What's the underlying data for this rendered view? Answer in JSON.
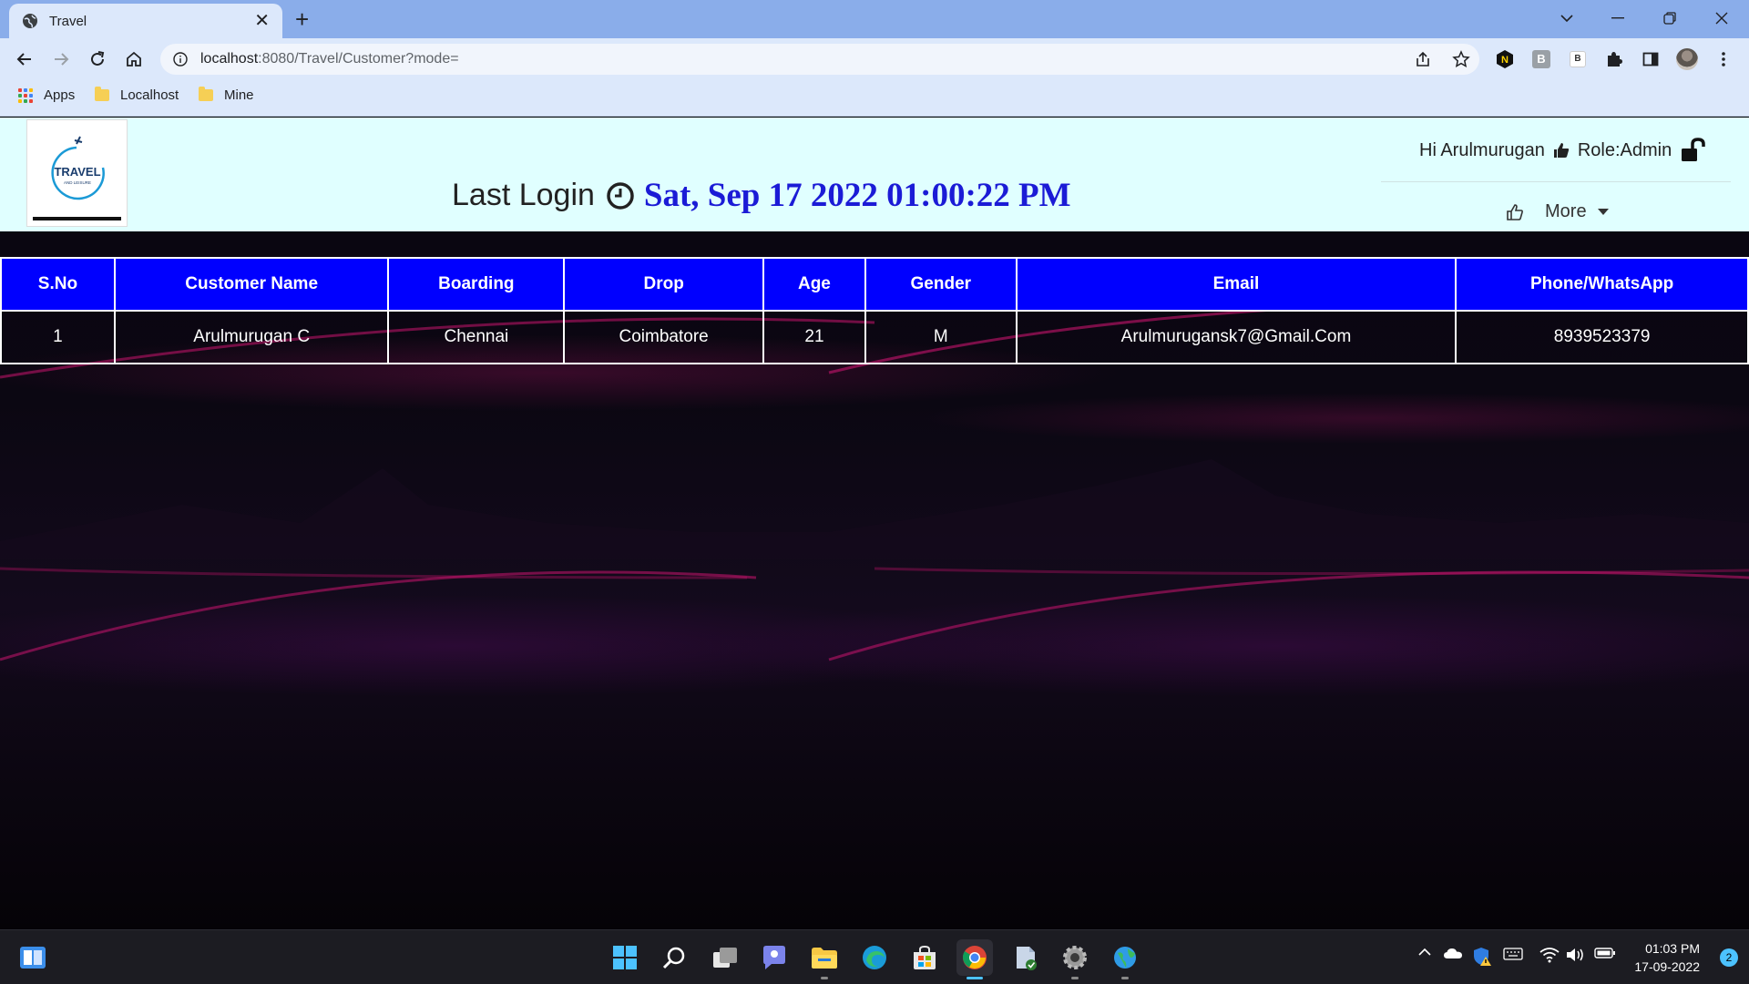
{
  "browser": {
    "tab_title": "Travel",
    "url_host": "localhost",
    "url_path": ":8080/Travel/Customer?mode=",
    "bookmarks": [
      {
        "label": "Apps",
        "icon": "apps-grid-icon"
      },
      {
        "label": "Localhost",
        "icon": "folder-icon"
      },
      {
        "label": "Mine",
        "icon": "folder-icon"
      }
    ],
    "extension_b_label": "B",
    "extension_b2_label": "B"
  },
  "header": {
    "logo_text": "TRAVEL",
    "logo_subtext": "AND LEISURE",
    "last_login_label": "Last Login",
    "last_login_date": "Sat, Sep 17 2022 01:00:22 PM",
    "greeting": "Hi Arulmurugan",
    "role": "Role:Admin",
    "more_label": "More"
  },
  "table": {
    "columns": [
      "S.No",
      "Customer Name",
      "Boarding",
      "Drop",
      "Age",
      "Gender",
      "Email",
      "Phone/WhatsApp"
    ],
    "rows": [
      [
        "1",
        "Arulmurugan C",
        "Chennai",
        "Coimbatore",
        "21",
        "M",
        "Arulmurugansk7@Gmail.Com",
        "8939523379"
      ]
    ]
  },
  "taskbar": {
    "time": "01:03 PM",
    "date": "17-09-2022",
    "notification_count": "2"
  },
  "colors": {
    "header_bg": "#e0ffff",
    "table_header_bg": "#0000ff",
    "date_color": "#1b1bd6",
    "chrome_frame": "#8aadea",
    "chrome_toolbar": "#dce8fb"
  }
}
